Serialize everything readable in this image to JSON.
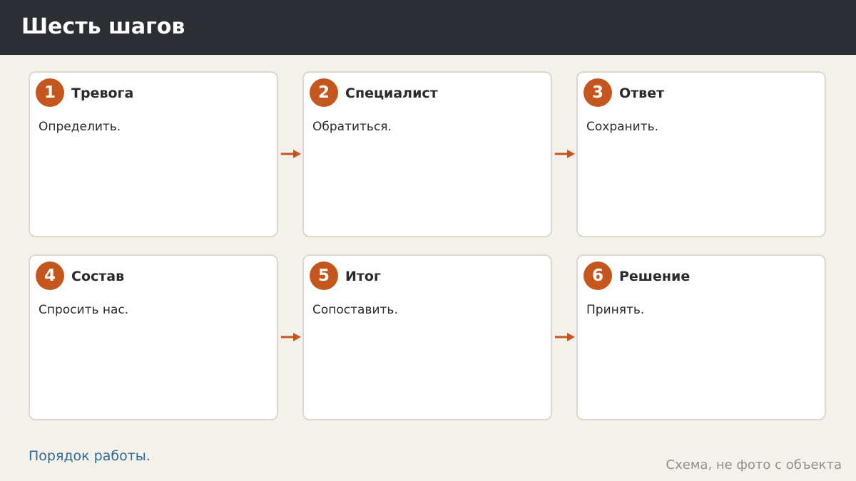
{
  "header": {
    "title": "Шесть шагов"
  },
  "accent_color": "#c4561e",
  "steps": [
    {
      "number": "1",
      "title": "Тревога",
      "text": "Определить."
    },
    {
      "number": "2",
      "title": "Специалист",
      "text": "Обратиться."
    },
    {
      "number": "3",
      "title": "Ответ",
      "text": "Сохранить."
    },
    {
      "number": "4",
      "title": "Состав",
      "text": "Спросить нас."
    },
    {
      "number": "5",
      "title": "Итог",
      "text": "Сопоставить."
    },
    {
      "number": "6",
      "title": "Решение",
      "text": "Принять."
    }
  ],
  "footer": {
    "link": "Порядок работы.",
    "note": "Схема, не фото с объекта"
  }
}
